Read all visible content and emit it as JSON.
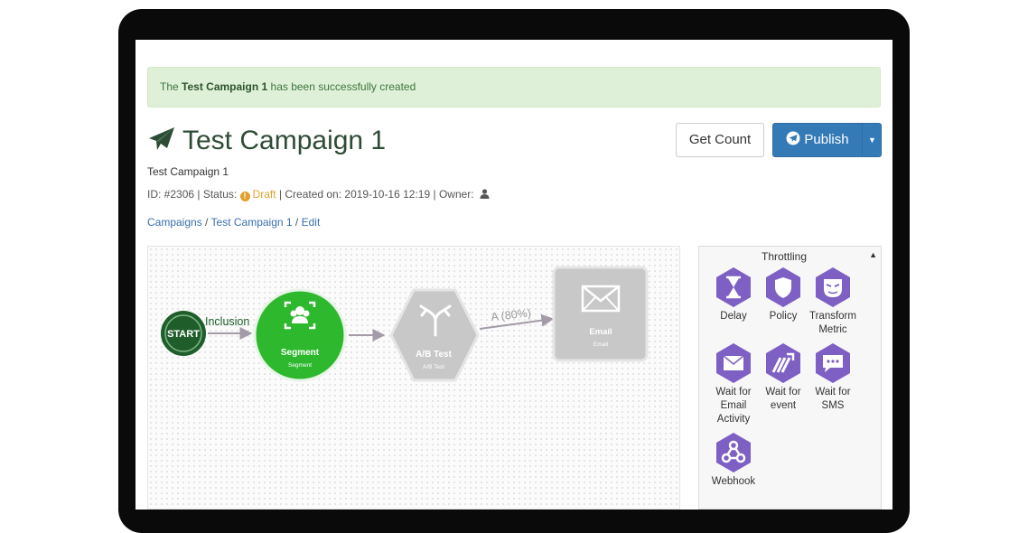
{
  "alert": {
    "prefix": "The",
    "campaign_name": "Test Campaign 1",
    "suffix": "has been successfully created"
  },
  "header": {
    "title": "Test Campaign 1",
    "subtitle": "Test Campaign 1"
  },
  "meta": {
    "id": "ID: #2306",
    "status_label": "Status:",
    "status_value": "Draft",
    "created": "Created on: 2019-10-16 12:19",
    "owner_label": "Owner:"
  },
  "breadcrumb": {
    "campaigns": "Campaigns",
    "campaign": "Test Campaign 1",
    "current": "Edit",
    "sep": "/"
  },
  "actions": {
    "get_count": "Get Count",
    "publish": "Publish"
  },
  "flow": {
    "start": {
      "label": "START"
    },
    "edge1": {
      "label": "Inclusion"
    },
    "segment": {
      "title": "Segment",
      "subtitle": "Segment"
    },
    "abtest": {
      "title": "A/B Test",
      "subtitle": "A/B Test"
    },
    "edge3": {
      "label": "A (80%)"
    },
    "email": {
      "title": "Email",
      "subtitle": "Email"
    }
  },
  "sidebar": {
    "title": "Throttling",
    "tools": [
      {
        "label": "Delay",
        "icon": "hourglass-icon"
      },
      {
        "label": "Policy",
        "icon": "shield-icon"
      },
      {
        "label": "Transform Metric",
        "icon": "mask-icon"
      },
      {
        "label": "Wait for Email Activity",
        "icon": "envelope-icon"
      },
      {
        "label": "Wait for event",
        "icon": "event-icon"
      },
      {
        "label": "Wait for SMS",
        "icon": "sms-icon"
      },
      {
        "label": "Webhook",
        "icon": "webhook-icon"
      }
    ]
  },
  "colors": {
    "accent": "#337ab7",
    "tool_purple": "#7e5fc4",
    "node_green": "#2eb82e",
    "node_gray": "#c8c8c8",
    "start_green": "#1f5e2b"
  }
}
